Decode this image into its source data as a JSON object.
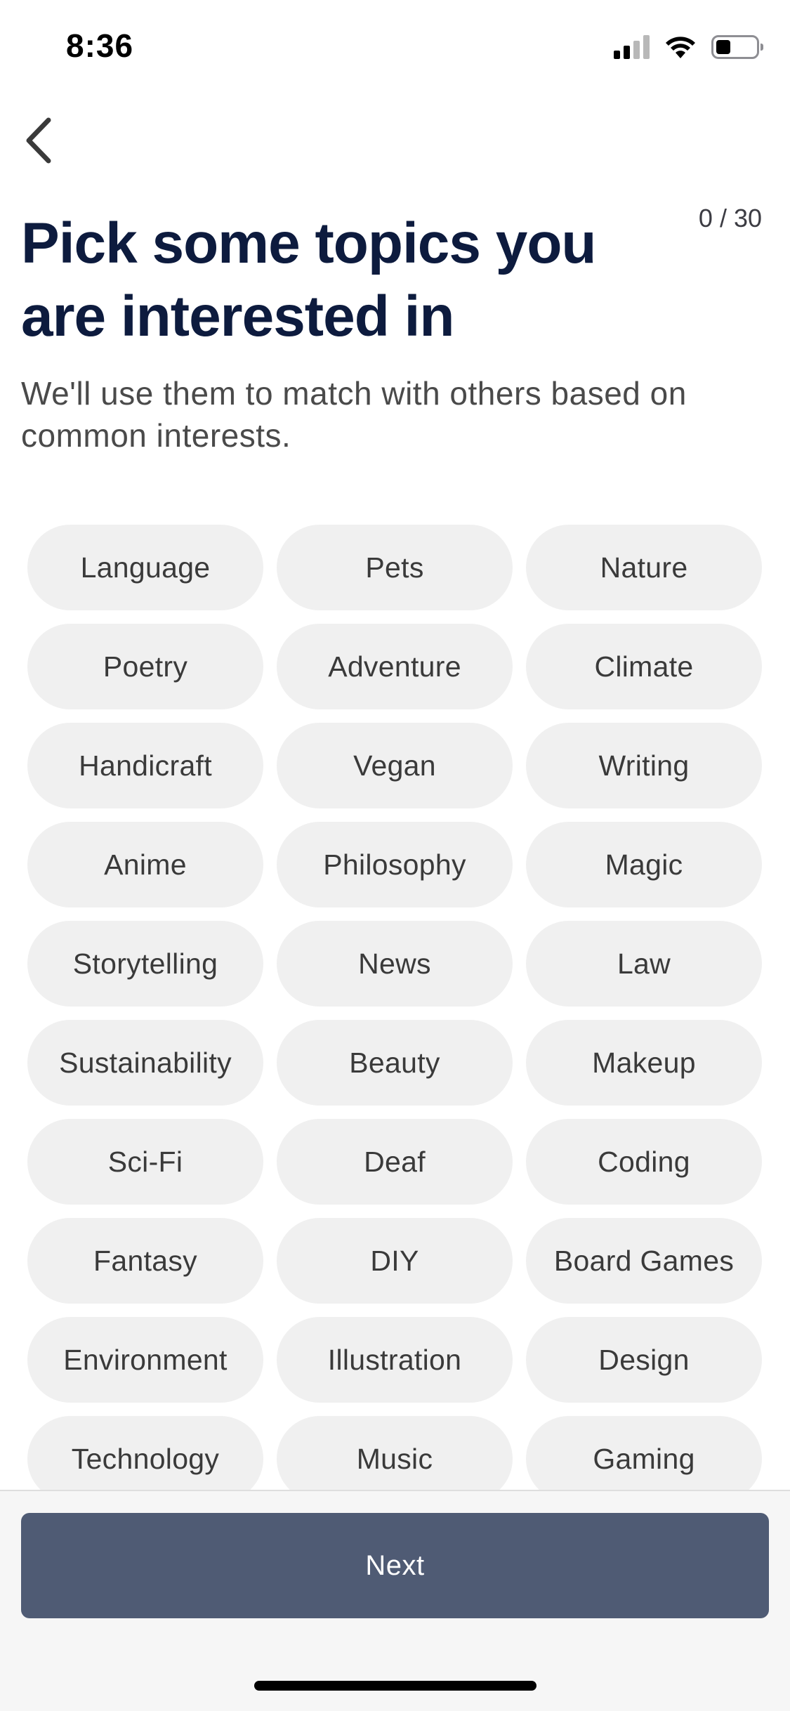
{
  "status_bar": {
    "time": "8:36"
  },
  "header": {
    "counter": "0 / 30",
    "title": "Pick some topics you are interested in",
    "subtitle": "We'll use them to match with others based on common interests."
  },
  "topics": [
    "Language",
    "Pets",
    "Nature",
    "Poetry",
    "Adventure",
    "Climate",
    "Handicraft",
    "Vegan",
    "Writing",
    "Anime",
    "Philosophy",
    "Magic",
    "Storytelling",
    "News",
    "Law",
    "Sustainability",
    "Beauty",
    "Makeup",
    "Sci-Fi",
    "Deaf",
    "Coding",
    "Fantasy",
    "DIY",
    "Board Games",
    "Environment",
    "Illustration",
    "Design",
    "Technology",
    "Music",
    "Gaming"
  ],
  "footer": {
    "next_label": "Next"
  },
  "colors": {
    "title": "#0d1b3e",
    "chip_background": "#f0f0f0",
    "next_button": "#4f5b74"
  }
}
